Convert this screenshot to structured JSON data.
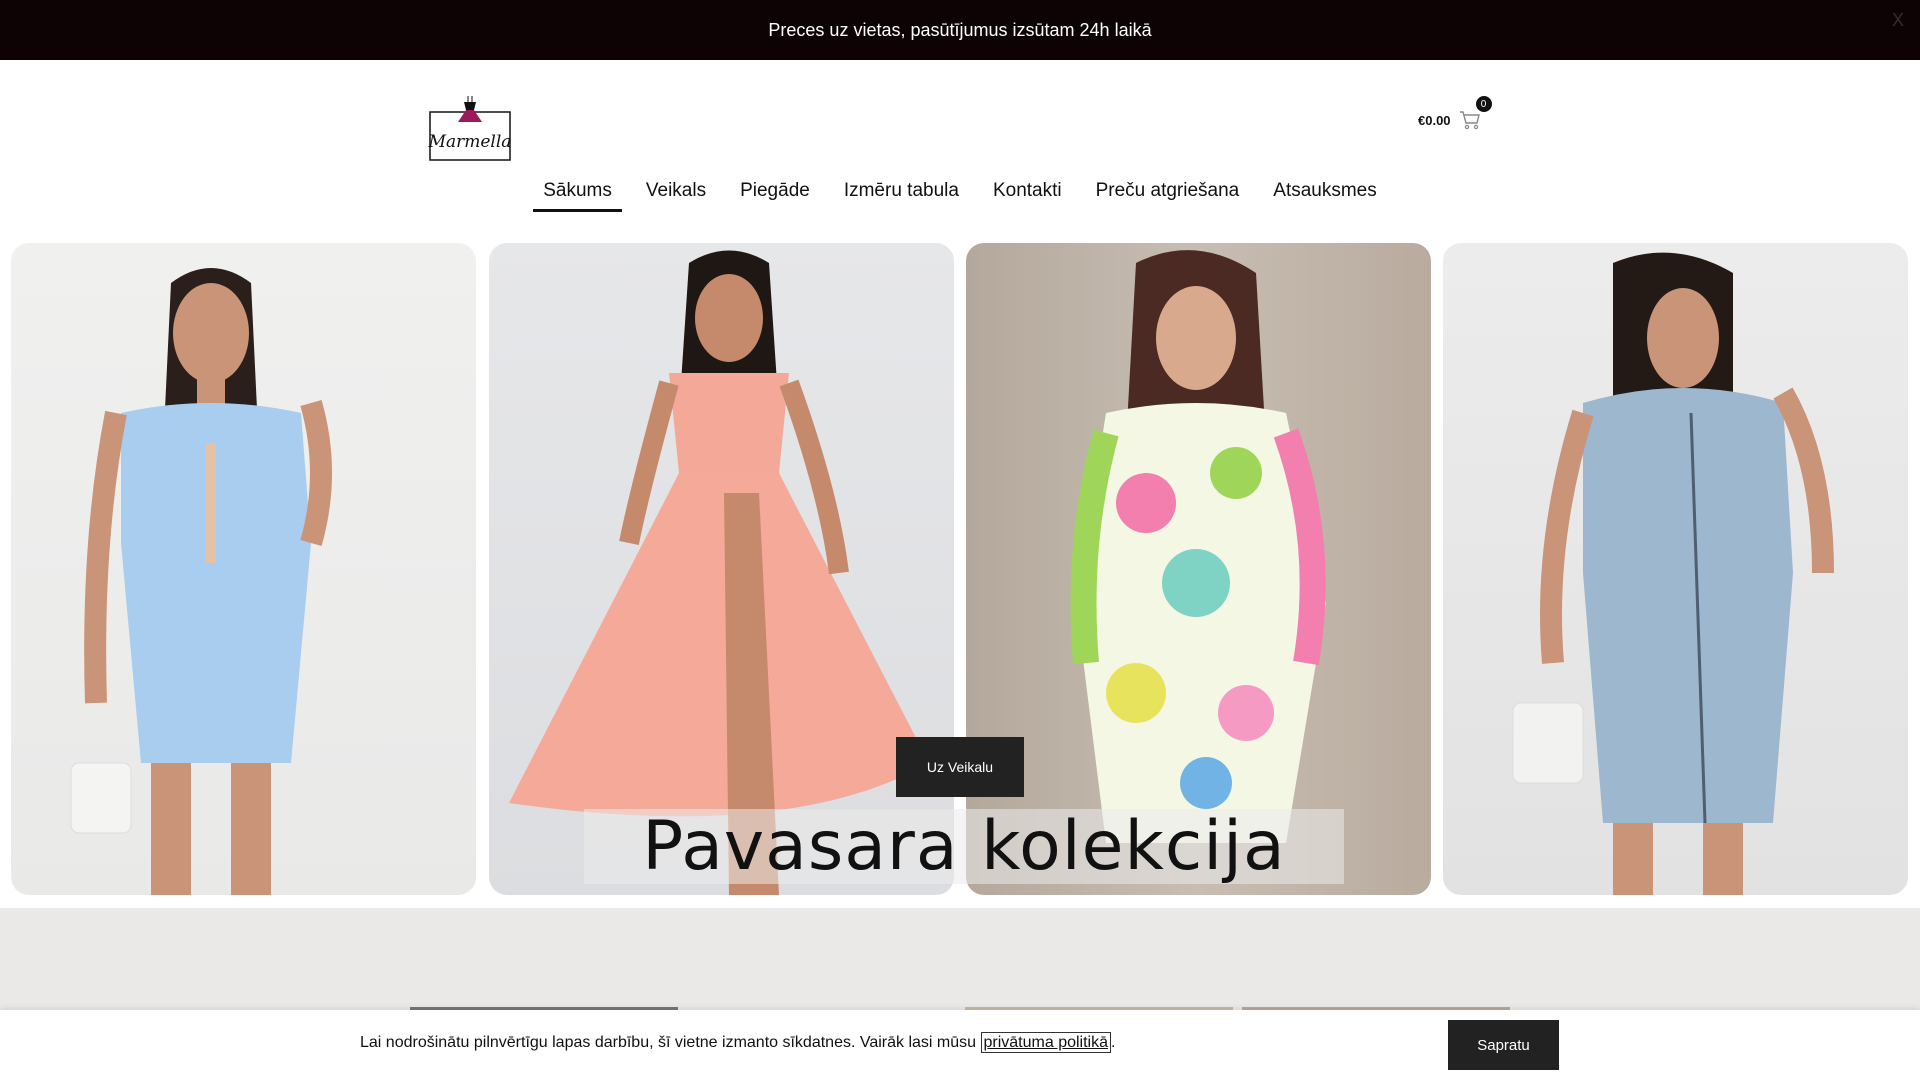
{
  "announcement": {
    "text": "Preces uz vietas, pasūtījumus izsūtam 24h laikā",
    "close_label": "X"
  },
  "header": {
    "logo_text": "Marmella",
    "cart": {
      "total": "€0.00",
      "count": "0"
    }
  },
  "nav": {
    "items": [
      {
        "label": "Sākums",
        "active": true
      },
      {
        "label": "Veikals"
      },
      {
        "label": "Piegāde"
      },
      {
        "label": "Izmēru tabula"
      },
      {
        "label": "Kontakti"
      },
      {
        "label": "Preču atgriešana"
      },
      {
        "label": "Atsauksmes"
      }
    ]
  },
  "hero": {
    "cta_label": "Uz Veikalu",
    "title": "Pavasara  kolekcija",
    "panels": [
      {
        "dress": "light blue ruched dress"
      },
      {
        "dress": "pink maxi dress"
      },
      {
        "dress": "floral wrap dress"
      },
      {
        "dress": "denim zip dress"
      }
    ]
  },
  "cookie": {
    "text": "Lai nodrošinātu pilnvērtīgu lapas darbību, šī vietne izmanto sīkdatnes. Vairāk lasi mūsu",
    "link": "privātuma politikā",
    "accept_label": "Sapratu"
  },
  "colors": {
    "topbar": "#0d0305",
    "dark_button": "#222222",
    "logo_accent": "#9b1b5a"
  }
}
